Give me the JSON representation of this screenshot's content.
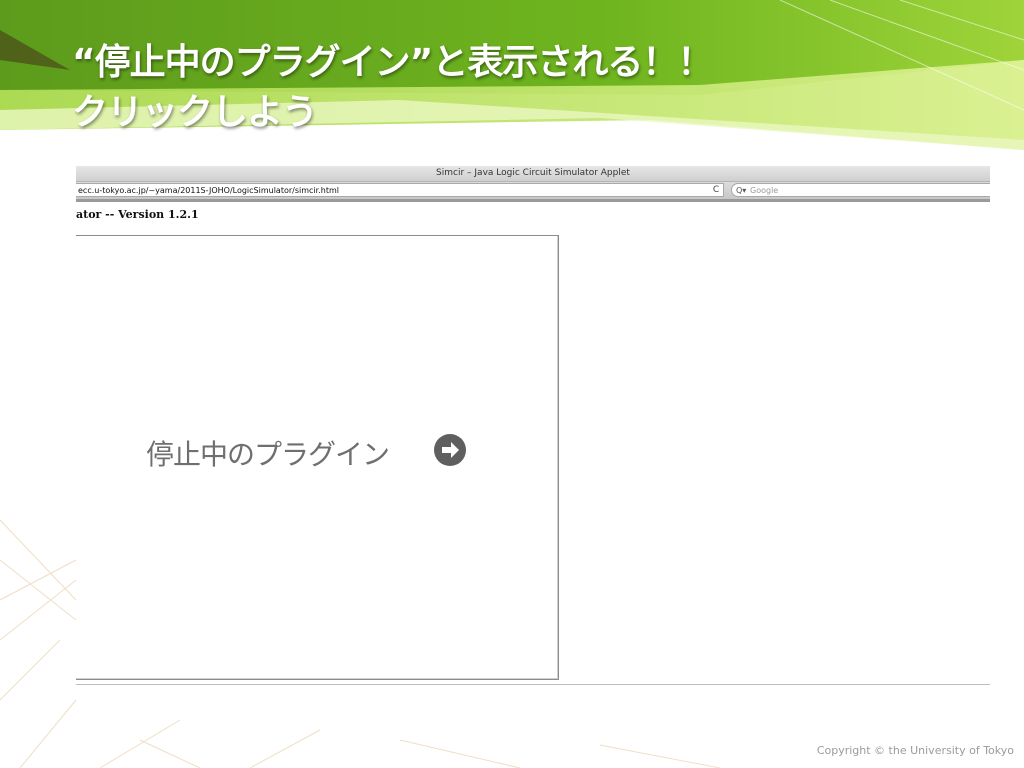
{
  "slide": {
    "title_line1": "“停止中のプラグイン”と表示される！！",
    "title_line2": "クリックしよう",
    "copyright": "Copyright © the University of Tokyo"
  },
  "browser": {
    "window_title": "Simcir – Java Logic Circuit Simulator Applet",
    "url": "ecc.u-tokyo.ac.jp/~yama/2011S-JOHO/LogicSimulator/simcir.html",
    "reload_icon": "C",
    "search_icon": "Q▾",
    "search_placeholder": "Google"
  },
  "page": {
    "heading": "ator -- Version 1.2.1",
    "plugin_label": "停止中のプラグイン",
    "plugin_arrow_icon": "arrow-right-circle-icon"
  }
}
